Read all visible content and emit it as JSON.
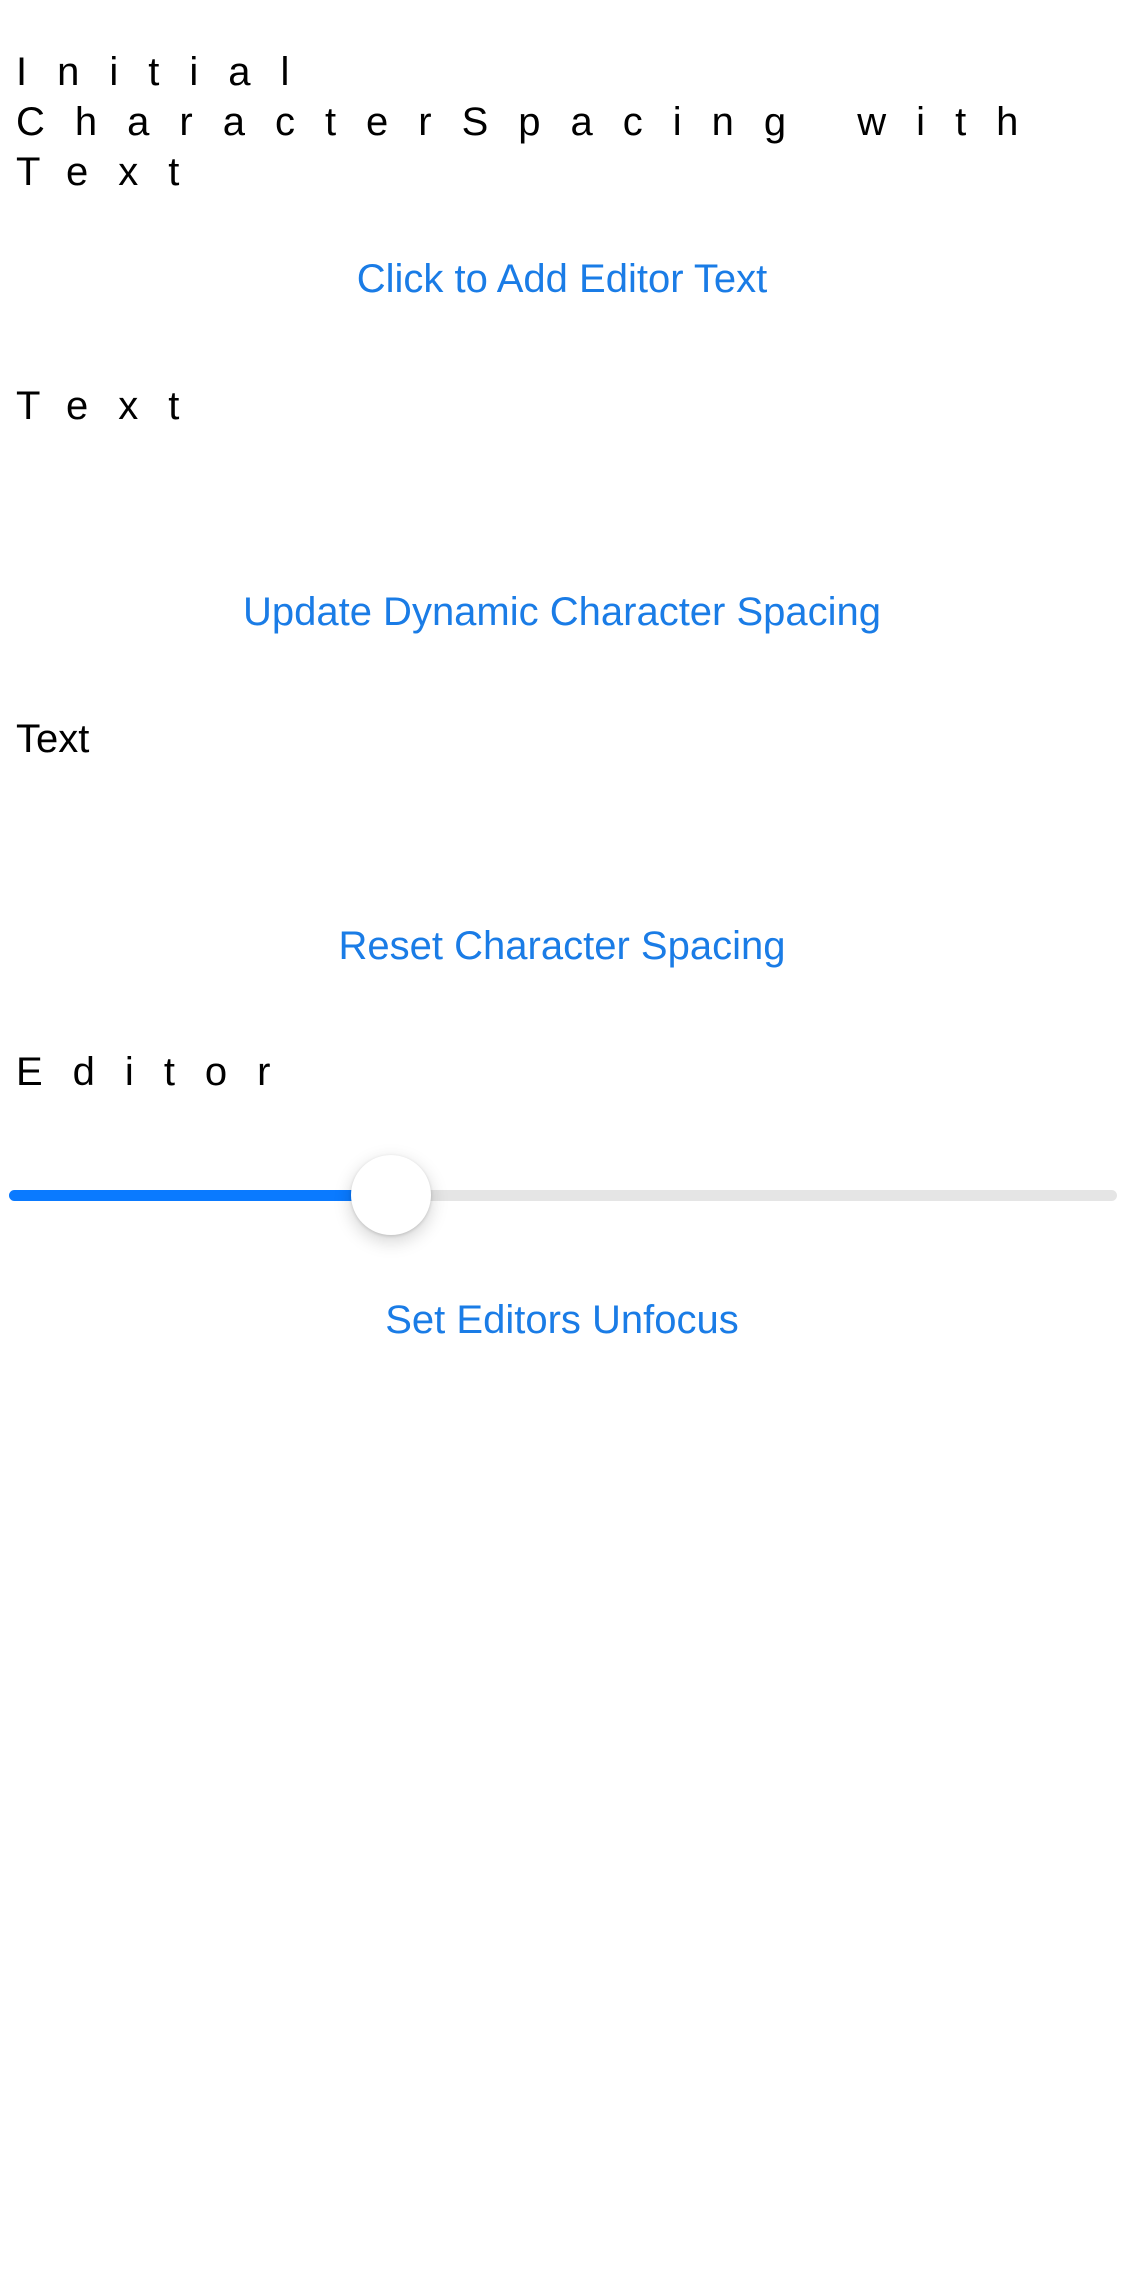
{
  "labels": {
    "initial_text": "Initial CharacterSpacing with Text",
    "text_spaced": "Text",
    "text_normal": "Text",
    "editor": "Editor"
  },
  "buttons": {
    "add_editor_text": "Click to Add Editor Text",
    "update_dynamic_spacing": "Update Dynamic Character Spacing",
    "reset_spacing": "Reset Character Spacing",
    "set_editors_unfocus": "Set Editors Unfocus"
  },
  "slider": {
    "value_fraction": 0.345
  },
  "colors": {
    "accent": "#0a7aff",
    "link": "#1a7ce6",
    "track": "#e5e5e5"
  }
}
